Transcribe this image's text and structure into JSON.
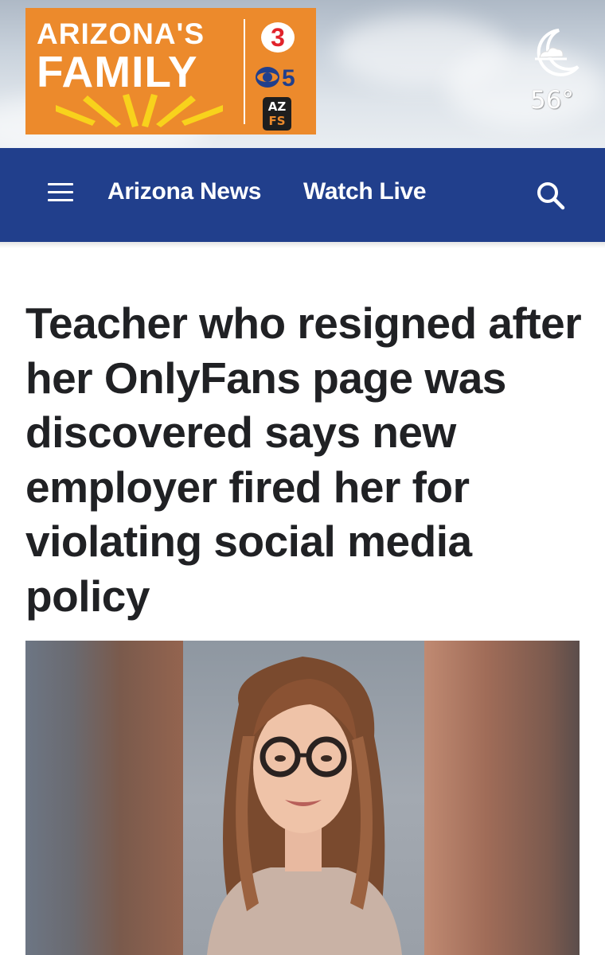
{
  "header": {
    "logo": {
      "line1": "ARIZONA'S",
      "line2": "FAMILY",
      "badge_3": "3",
      "badge_cbs": "5",
      "badge_azfs_top": "AZ",
      "badge_azfs_bottom": "FS"
    },
    "weather": {
      "icon": "moon-cloud-icon",
      "temperature": "56°"
    }
  },
  "nav": {
    "menu_icon": "hamburger-menu-icon",
    "links": [
      "Arizona News",
      "Watch Live"
    ],
    "search_icon": "search-icon"
  },
  "article": {
    "headline": "Teacher who resigned after her OnlyFans page was discovered says new employer fired her for violating social media policy"
  },
  "colors": {
    "brand_orange": "#ec8a2c",
    "nav_blue": "#213f8c",
    "headline_text": "#202124"
  }
}
